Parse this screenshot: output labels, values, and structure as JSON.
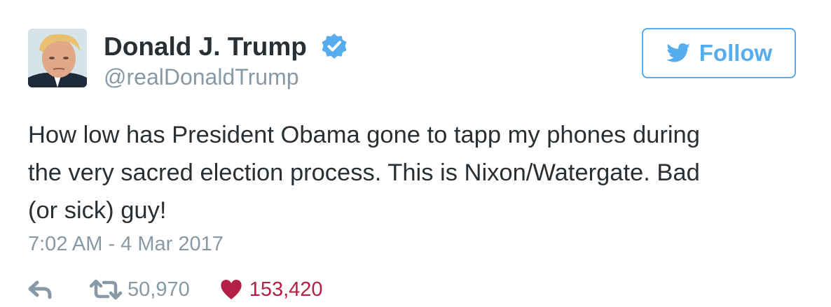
{
  "user": {
    "display_name": "Donald J. Trump",
    "handle": "@realDonaldTrump",
    "verified": true
  },
  "follow": {
    "label": "Follow",
    "icon": "twitter-bird-icon"
  },
  "tweet": {
    "text": "How low has President Obama gone to tapp my phones during\nthe very sacred election process. This is Nixon/Watergate. Bad\n(or sick) guy!",
    "timestamp": "7:02 AM - 4 Mar 2017"
  },
  "actions": {
    "reply_icon": "reply-icon",
    "retweet_icon": "retweet-icon",
    "retweet_count": "50,970",
    "like_icon": "heart-icon",
    "like_count": "153,420"
  },
  "colors": {
    "twitter_blue": "#55acee",
    "text": "#292f33",
    "muted": "#8899a6",
    "like_red": "#b31f45",
    "verified_blue": "#55acee"
  }
}
